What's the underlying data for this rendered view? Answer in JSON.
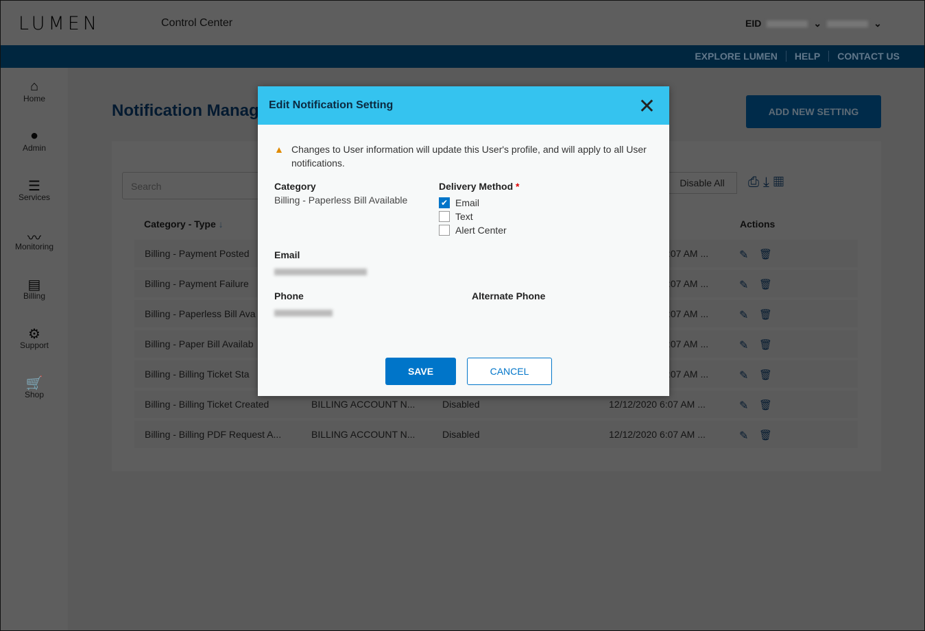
{
  "header": {
    "logo": "LUMEN",
    "app_title": "Control Center",
    "eid_label": "EID"
  },
  "top_links": [
    "EXPLORE LUMEN",
    "HELP",
    "CONTACT US"
  ],
  "sidebar": {
    "items": [
      {
        "label": "Home",
        "icon": "⌂"
      },
      {
        "label": "Admin",
        "icon": "●"
      },
      {
        "label": "Services",
        "icon": "☰"
      },
      {
        "label": "Monitoring",
        "icon": "〰"
      },
      {
        "label": "Billing",
        "icon": "▤"
      },
      {
        "label": "Support",
        "icon": "⚙"
      },
      {
        "label": "Shop",
        "icon": "🛒"
      }
    ]
  },
  "page": {
    "title": "Notification Manag",
    "add_button": "ADD NEW SETTING",
    "search_placeholder": "Search",
    "disable_all": "Disable All"
  },
  "table": {
    "headers": {
      "category": "Category - Type",
      "actions": "Actions"
    },
    "rows": [
      {
        "category": "Billing - Payment Posted",
        "type": "",
        "status": "",
        "date": ":07 AM ..."
      },
      {
        "category": "Billing - Payment Failure",
        "type": "",
        "status": "",
        "date": ":07 AM ..."
      },
      {
        "category": "Billing - Paperless Bill Ava",
        "type": "",
        "status": "",
        "date": ":07 AM ..."
      },
      {
        "category": "Billing - Paper Bill Availab",
        "type": "",
        "status": "",
        "date": ":07 AM ..."
      },
      {
        "category": "Billing - Billing Ticket Sta",
        "type": "",
        "status": "",
        "date": ":07 AM ..."
      },
      {
        "category": "Billing - Billing Ticket Created",
        "type": "BILLING ACCOUNT N...",
        "status": "Disabled",
        "date": "12/12/2020 6:07 AM ..."
      },
      {
        "category": "Billing - Billing PDF Request A...",
        "type": "BILLING ACCOUNT N...",
        "status": "Disabled",
        "date": "12/12/2020 6:07 AM ..."
      }
    ]
  },
  "modal": {
    "title": "Edit Notification Setting",
    "warning": "Changes to User information will update this User's profile, and will apply to all User notifications.",
    "category_label": "Category",
    "category_value": "Billing - Paperless Bill Available",
    "delivery_label": "Delivery Method",
    "required_mark": "*",
    "options": [
      {
        "label": "Email",
        "checked": true
      },
      {
        "label": "Text",
        "checked": false
      },
      {
        "label": "Alert Center",
        "checked": false
      }
    ],
    "email_label": "Email",
    "phone_label": "Phone",
    "alt_phone_label": "Alternate Phone",
    "save": "SAVE",
    "cancel": "CANCEL"
  },
  "colors": {
    "modal_header": "#35c3ef",
    "primary": "#0075c9",
    "navy": "#004170"
  }
}
